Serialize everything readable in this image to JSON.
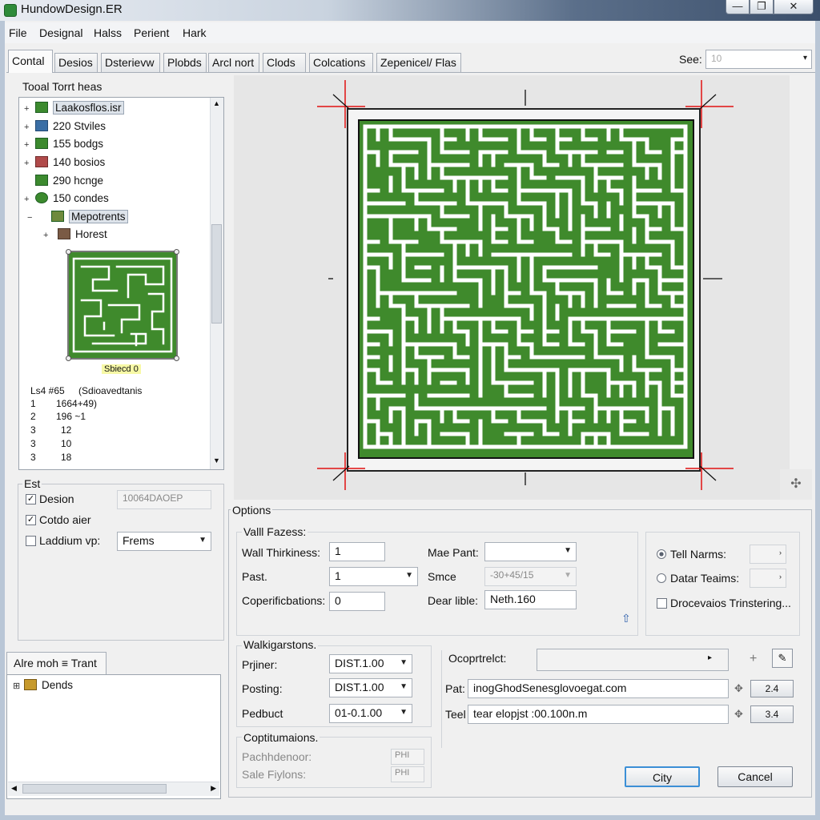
{
  "window": {
    "title": "HundowDesign.ER",
    "buttons": {
      "minimize": "—",
      "maximize": "❐",
      "close": "✕"
    }
  },
  "menu": [
    "File",
    "Designal",
    "Halss",
    "Perient",
    "Hark"
  ],
  "tabs": [
    "Contal",
    "Desios",
    "Dsterievw",
    "Plobds",
    "Arcl nort",
    "Clods",
    "Colcations",
    "Zepenicel/ Flas"
  ],
  "see": {
    "label": "See:",
    "value": "10"
  },
  "tree": {
    "title": "Tooal Torrt heas",
    "items": [
      {
        "expander": "+",
        "label": "Laakosflos.isr",
        "selected": true
      },
      {
        "expander": "+",
        "label": "220 Stviles"
      },
      {
        "expander": "+",
        "label": "155 bodgs"
      },
      {
        "expander": "+",
        "label": "140 bosios"
      },
      {
        "expander": "",
        "label": "290 hcnge"
      },
      {
        "expander": "+",
        "label": "150 condes"
      },
      {
        "expander": "−",
        "label": "Mepotrents",
        "selected": true
      },
      {
        "expander": "+",
        "label": "Horest"
      }
    ],
    "thumbnail_label": "Sbiecd 0",
    "grid": {
      "header": [
        "Ls4 #65",
        "(Sdioavedtanis"
      ],
      "rows": [
        [
          "1",
          "1664+49)"
        ],
        [
          "2",
          "196 ~1"
        ],
        [
          "3",
          "12"
        ],
        [
          "3",
          "10"
        ],
        [
          "3",
          "18"
        ]
      ]
    }
  },
  "est": {
    "title": "Est",
    "design_label": "Desion",
    "design_checked": true,
    "design_value": "10064DAOEP",
    "cotto_label": "Cotdo aier",
    "cotto_checked": true,
    "laddium_label": "Laddium vp:",
    "laddium_checked": false,
    "laddium_value": "Frems"
  },
  "alt_tab": {
    "label": "Alre moh ≡ Trant",
    "item": "Dends"
  },
  "options": {
    "title": "Options",
    "wall": {
      "title": "Valll Fazess:",
      "thickness_label": "Wall Thirkiness:",
      "thickness_value": "1",
      "past_label": "Past.",
      "past_value": "1",
      "copert_label": "Coperificbations:",
      "copert_value": "0",
      "mae_label": "Mae Pant:",
      "mae_value": "",
      "smce_label": "Smce",
      "smce_value": "-30+45/15",
      "dear_label": "Dear lible:",
      "dear_value": "Neth.160"
    },
    "right": {
      "tell_label": "Tell Narms:",
      "tell_selected": true,
      "datar_label": "Datar Teaims:",
      "drocevaios_label": "Drocevaios Trinstering..."
    },
    "walk": {
      "title": "Walkigarstons.",
      "prjiner_label": "Prjiner:",
      "prjiner_value": "DIST.1.00",
      "posting_label": "Posting:",
      "posting_value": "DIST.1.00",
      "pedbuct_label": "Pedbuct",
      "pedbuct_value": "01-0.1.00"
    },
    "cop": {
      "title": "Coptitumaions.",
      "pach_label": "Pachhdenoor:",
      "pach_value": "PHI",
      "sale_label": "Sale Fiylons:",
      "sale_value": "PHI"
    },
    "copt": {
      "title": "Ocoprtrelct:",
      "pat_label": "Pat:",
      "pat_value": "inogGhodSenesglovoegat.com",
      "pat_btn": "2.4",
      "teel_label": "Teel",
      "teel_value": "tear elopjst :00.100n.m",
      "teel_btn": "3.4"
    }
  },
  "buttons": {
    "ok": "City",
    "cancel": "Cancel"
  },
  "colors": {
    "maze_green": "#3f8a2c",
    "maze_wall": "#ffffff",
    "guide_red": "#e01010",
    "accent": "#3b8fd6"
  },
  "icons": [
    "app-icon",
    "tree-node-icon",
    "arrow-icon",
    "add-icon",
    "edit-icon",
    "expand-icon"
  ]
}
